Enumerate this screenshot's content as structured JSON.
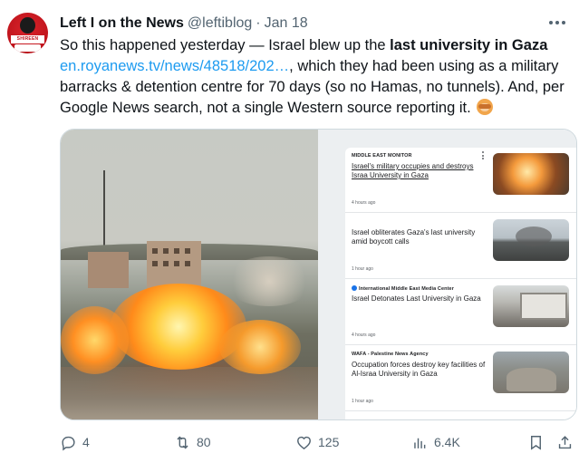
{
  "author": {
    "name": "Left I on the News",
    "handle": "@leftiblog",
    "separator": "·",
    "date": "Jan 18",
    "avatar_text": "SHIREEN ABUAKLEH"
  },
  "tweet": {
    "text_part1": "So this happened yesterday — Israel blew up the ",
    "text_bold": "last university in Gaza",
    "text_part2": " ",
    "link": "en.royanews.tv/news/48518/202…",
    "text_part3": ", which they had been using as a military barracks & detention centre for 70 days (so no Hamas, no tunnels). And, per Google News search, not a single Western source reporting it. ",
    "emoji": "see-no-evil-monkey"
  },
  "news": [
    {
      "source": "MIDDLE EAST MONITOR",
      "headline": "Israel's military occupies and destroys Israa University in Gaza",
      "time": "4 hours ago",
      "thumb_icon": "explosion"
    },
    {
      "source": "",
      "headline": "Israel obliterates Gaza's last university amid boycott calls",
      "time": "1 hour ago",
      "thumb_icon": "smoke-cityscape"
    },
    {
      "source": "International Middle East Media Center",
      "headline": "Israel Detonates Last University in Gaza",
      "time": "4 hours ago",
      "thumb_icon": "building"
    },
    {
      "source": "WAFA - Palestine News Agency",
      "headline": "Occupation forces destroy key facilities of Al-Israa University in Gaza",
      "time": "1 hour ago",
      "thumb_icon": "rubble"
    }
  ],
  "actions": {
    "replies": "4",
    "retweets": "80",
    "likes": "125",
    "views": "6.4K"
  },
  "colors": {
    "link": "#1d9bf0",
    "muted": "#536471",
    "text": "#0f1419"
  }
}
